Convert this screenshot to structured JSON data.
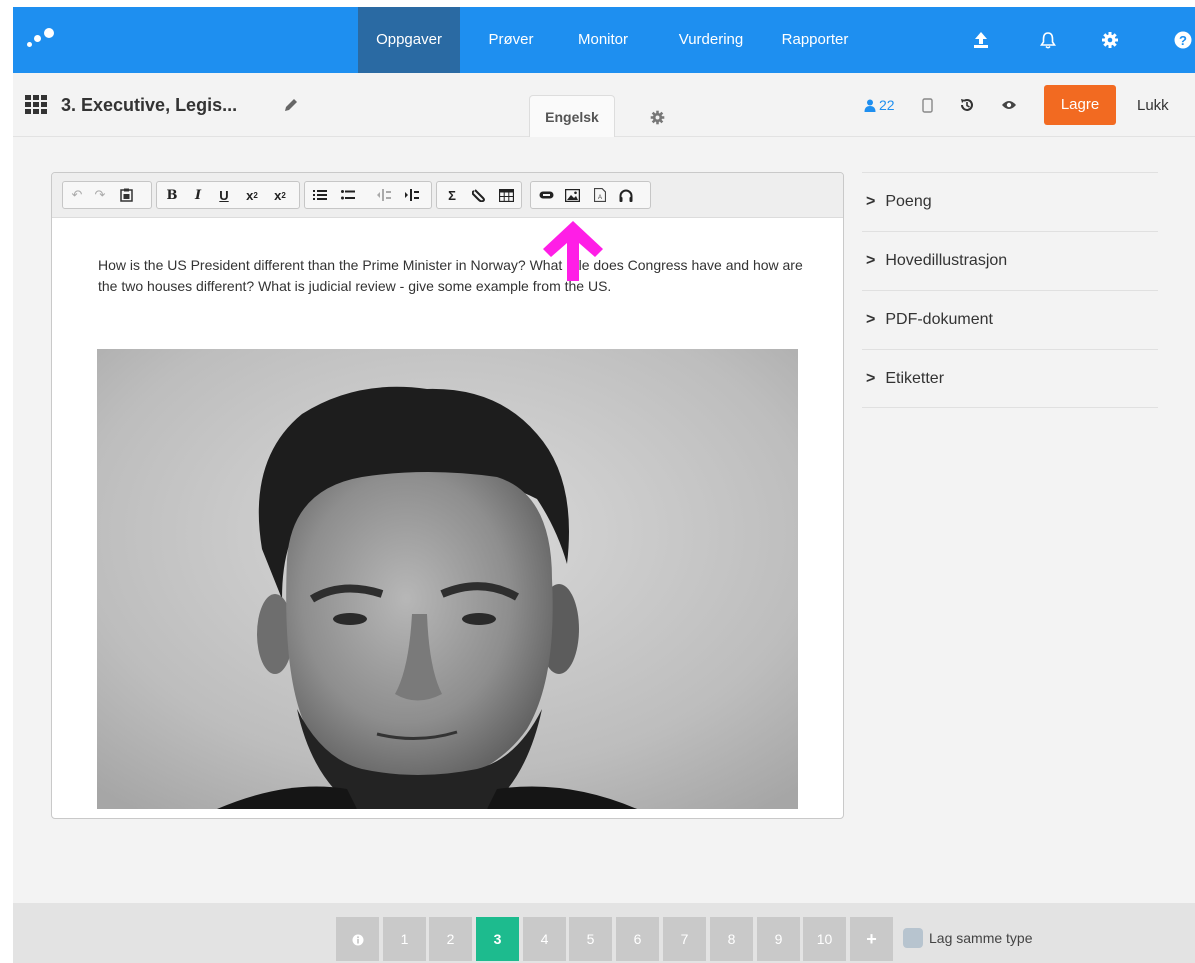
{
  "nav": {
    "tabs": [
      {
        "label": "Oppgaver",
        "active": true
      },
      {
        "label": "Prøver"
      },
      {
        "label": "Monitor"
      },
      {
        "label": "Vurdering"
      },
      {
        "label": "Rapporter"
      }
    ],
    "icons": [
      "upload-icon",
      "bell-icon",
      "gear-icon",
      "help-icon"
    ]
  },
  "header": {
    "title": "3. Executive, Legis...",
    "language_tab": "Engelsk",
    "user_count": "22",
    "save_label": "Lagre",
    "close_label": "Lukk"
  },
  "editor": {
    "question_text": "How is the US President different than the Prime Minister in Norway?  What role does Congress have and how are the two houses different? What is judicial review - give some example from the US."
  },
  "panel": {
    "items": [
      {
        "label": "Poeng"
      },
      {
        "label": "Hovedillustrasjon"
      },
      {
        "label": "PDF-dokument"
      },
      {
        "label": "Etiketter"
      }
    ]
  },
  "footer": {
    "pages": [
      "1",
      "2",
      "3",
      "4",
      "5",
      "6",
      "7",
      "8",
      "9",
      "10"
    ],
    "active_page": "3",
    "same_type_label": "Lag samme type"
  },
  "colors": {
    "nav_bg": "#1e8ff0",
    "nav_active": "#2a6aa3",
    "save_button": "#f26a21",
    "active_page": "#1dbb8e",
    "arrow": "#ff1ee6"
  }
}
